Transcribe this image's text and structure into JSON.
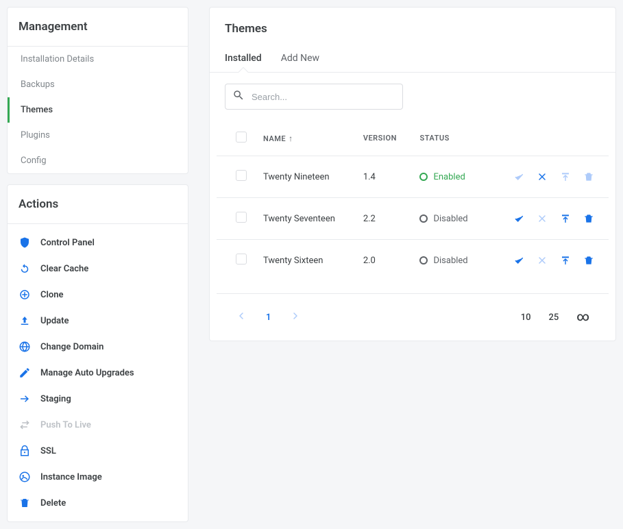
{
  "sidebar": {
    "management_title": "Management",
    "items": [
      {
        "label": "Installation Details",
        "active": false
      },
      {
        "label": "Backups",
        "active": false
      },
      {
        "label": "Themes",
        "active": true
      },
      {
        "label": "Plugins",
        "active": false
      },
      {
        "label": "Config",
        "active": false
      }
    ],
    "actions_title": "Actions",
    "actions": [
      {
        "label": "Control Panel",
        "icon": "shield-icon",
        "disabled": false
      },
      {
        "label": "Clear Cache",
        "icon": "refresh-icon",
        "disabled": false
      },
      {
        "label": "Clone",
        "icon": "clone-icon",
        "disabled": false
      },
      {
        "label": "Update",
        "icon": "upload-icon",
        "disabled": false
      },
      {
        "label": "Change Domain",
        "icon": "globe-icon",
        "disabled": false
      },
      {
        "label": "Manage Auto Upgrades",
        "icon": "pencil-icon",
        "disabled": false
      },
      {
        "label": "Staging",
        "icon": "arrow-right-icon",
        "disabled": false
      },
      {
        "label": "Push To Live",
        "icon": "sync-icon",
        "disabled": true
      },
      {
        "label": "SSL",
        "icon": "lock-icon",
        "disabled": false
      },
      {
        "label": "Instance Image",
        "icon": "image-icon",
        "disabled": false
      },
      {
        "label": "Delete",
        "icon": "trash-icon",
        "disabled": false
      }
    ]
  },
  "main": {
    "title": "Themes",
    "tabs": [
      {
        "label": "Installed",
        "active": true
      },
      {
        "label": "Add New",
        "active": false
      }
    ],
    "search_placeholder": "Search...",
    "columns": {
      "name": "Name",
      "version": "Version",
      "status": "Status"
    },
    "rows": [
      {
        "name": "Twenty Nineteen",
        "version": "1.4",
        "status": "Enabled",
        "enabled": true
      },
      {
        "name": "Twenty Seventeen",
        "version": "2.2",
        "status": "Disabled",
        "enabled": false
      },
      {
        "name": "Twenty Sixteen",
        "version": "2.0",
        "status": "Disabled",
        "enabled": false
      }
    ],
    "pagination": {
      "current_page": "1",
      "sizes": [
        "10",
        "25",
        "∞"
      ]
    }
  }
}
